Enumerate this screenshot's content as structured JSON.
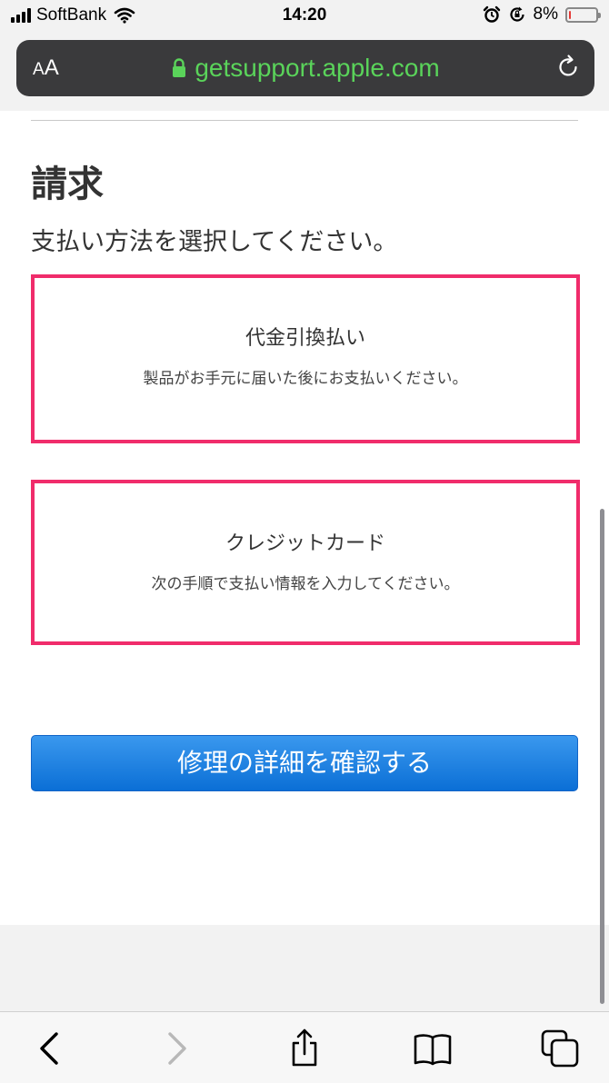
{
  "status_bar": {
    "carrier": "SoftBank",
    "time": "14:20",
    "battery_percent": "8%",
    "battery_level": 0.08,
    "battery_color": "#e53935",
    "icons": [
      "signal-icon",
      "wifi-icon",
      "alarm-icon",
      "rotation-lock-icon",
      "battery-icon"
    ]
  },
  "address_bar": {
    "text_size_label_small": "A",
    "text_size_label_big": "A",
    "url": "getsupport.apple.com",
    "url_color": "#5ad35a",
    "icons": [
      "lock-icon",
      "reload-icon"
    ]
  },
  "page": {
    "title": "請求",
    "subtitle": "支払い方法を選択してください。",
    "options": [
      {
        "title": "代金引換払い",
        "description": "製品がお手元に届いた後にお支払いください。"
      },
      {
        "title": "クレジットカード",
        "description": "次の手順で支払い情報を入力してください。"
      }
    ],
    "highlight_color": "#f02c6b",
    "confirm_button": "修理の詳細を確認する",
    "button_color": "#1a7fe0"
  },
  "toolbar": {
    "icons": [
      "back-icon",
      "forward-icon",
      "share-icon",
      "bookmarks-icon",
      "tabs-icon"
    ]
  }
}
